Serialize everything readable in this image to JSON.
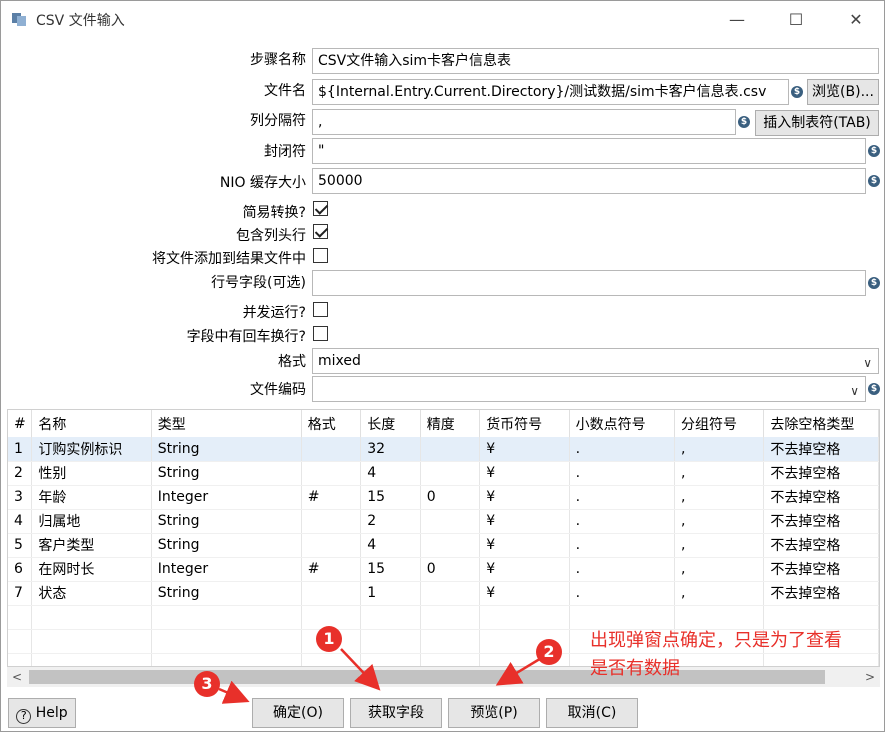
{
  "window": {
    "title": "CSV 文件输入"
  },
  "form": {
    "step_name_label": "步骤名称",
    "step_name_value": "CSV文件输入sim卡客户信息表",
    "filename_label": "文件名",
    "filename_value": "${Internal.Entry.Current.Directory}/测试数据/sim卡客户信息表.csv",
    "browse_label": "浏览(B)...",
    "delimiter_label": "列分隔符",
    "delimiter_value": ",",
    "insert_tab_label": "插入制表符(TAB)",
    "enclosure_label": "封闭符",
    "enclosure_value": "\"",
    "nio_label": "NIO 缓存大小",
    "nio_value": "50000",
    "lazy_label": "简易转换?",
    "lazy_checked": true,
    "header_label": "包含列头行",
    "header_checked": true,
    "add_result_label": "将文件添加到结果文件中",
    "add_result_checked": false,
    "rownum_label": "行号字段(可选)",
    "rownum_value": "",
    "parallel_label": "并发运行?",
    "parallel_checked": false,
    "newline_label": "字段中有回车换行?",
    "newline_checked": false,
    "format_label": "格式",
    "format_value": "mixed",
    "encoding_label": "文件编码",
    "encoding_value": ""
  },
  "table": {
    "columns": [
      "#",
      "名称",
      "类型",
      "格式",
      "长度",
      "精度",
      "货币符号",
      "小数点符号",
      "分组符号",
      "去除空格类型"
    ],
    "rows": [
      [
        "1",
        "订购实例标识",
        "String",
        "",
        "32",
        "",
        "¥",
        ".",
        ",",
        "不去掉空格"
      ],
      [
        "2",
        "性别",
        "String",
        "",
        "4",
        "",
        "¥",
        ".",
        ",",
        "不去掉空格"
      ],
      [
        "3",
        "年龄",
        "Integer",
        "#",
        "15",
        "0",
        "¥",
        ".",
        ",",
        "不去掉空格"
      ],
      [
        "4",
        "归属地",
        "String",
        "",
        "2",
        "",
        "¥",
        ".",
        ",",
        "不去掉空格"
      ],
      [
        "5",
        "客户类型",
        "String",
        "",
        "4",
        "",
        "¥",
        ".",
        ",",
        "不去掉空格"
      ],
      [
        "6",
        "在网时长",
        "Integer",
        "#",
        "15",
        "0",
        "¥",
        ".",
        ",",
        "不去掉空格"
      ],
      [
        "7",
        "状态",
        "String",
        "",
        "1",
        "",
        "¥",
        ".",
        ",",
        "不去掉空格"
      ]
    ]
  },
  "buttons": {
    "help": "Help",
    "ok": "确定(O)",
    "get_fields": "获取字段",
    "preview": "预览(P)",
    "cancel": "取消(C)"
  },
  "annotations": {
    "marker1": "1",
    "marker2": "2",
    "marker3": "3",
    "note_line1": "出现弹窗点确定，只是为了查看",
    "note_line2": "是否有数据",
    "color": "#e8302a"
  },
  "icons": {
    "variable": "$"
  }
}
